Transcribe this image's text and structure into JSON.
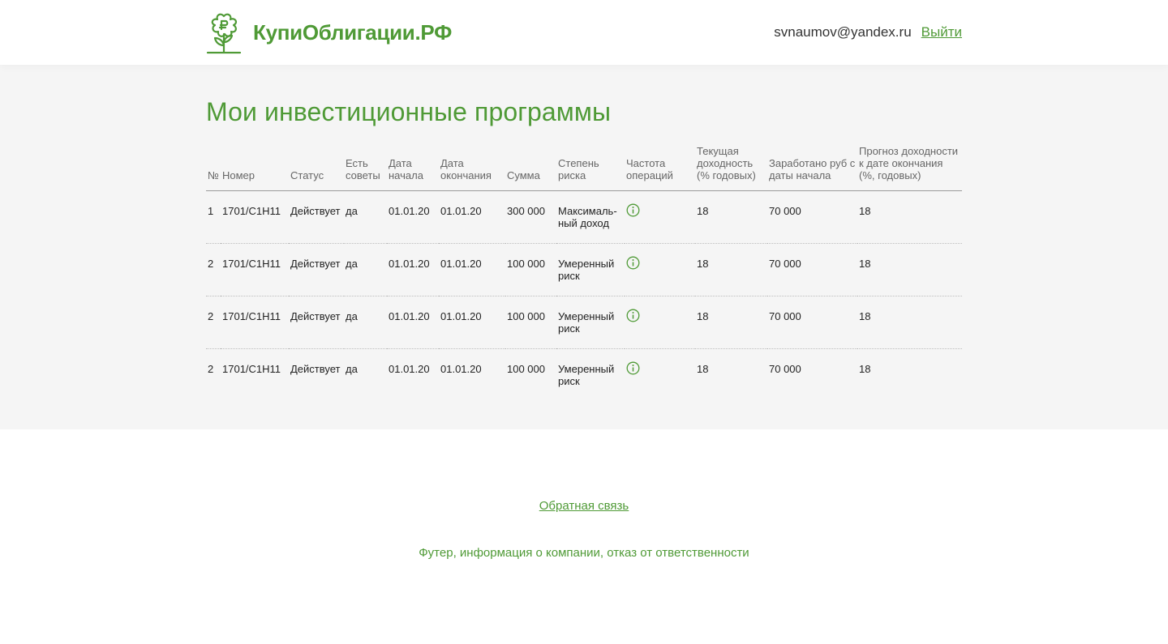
{
  "header": {
    "logo_text": "КупиОблигации.РФ",
    "logo_icon": "flower-ruble-icon",
    "user_email": "svnaumov@yandex.ru",
    "logout_label": "Выйти"
  },
  "main": {
    "title": "Мои инвестиционные программы",
    "columns": {
      "num": "№",
      "number": "Номер",
      "status": "Статус",
      "advice": "Есть советы",
      "start": "Дата начала",
      "end": "Дата окончания",
      "sum": "Сумма",
      "risk": "Степень риска",
      "freq": "Частота операций",
      "yield": "Текущая доходность (% годовых)",
      "earned": "Заработано руб с даты начала",
      "forecast": "Прогноз доходности к дате окончания (%, годовых)"
    },
    "rows": [
      {
        "num": "1",
        "number": "1701/C1H11",
        "status": "Действует",
        "advice": "да",
        "start": "01.01.20",
        "end": "01.01.20",
        "sum": "300 000",
        "risk": "Максималь-ный доход",
        "freq_icon": "info-icon",
        "yield": "18",
        "earned": "70 000",
        "forecast": "18"
      },
      {
        "num": "2",
        "number": "1701/C1H11",
        "status": "Действует",
        "advice": "да",
        "start": "01.01.20",
        "end": "01.01.20",
        "sum": "100 000",
        "risk": "Умеренный риск",
        "freq_icon": "info-icon",
        "yield": "18",
        "earned": "70 000",
        "forecast": "18"
      },
      {
        "num": "2",
        "number": "1701/C1H11",
        "status": "Действует",
        "advice": "да",
        "start": "01.01.20",
        "end": "01.01.20",
        "sum": "100 000",
        "risk": "Умеренный риск",
        "freq_icon": "info-icon",
        "yield": "18",
        "earned": "70 000",
        "forecast": "18"
      },
      {
        "num": "2",
        "number": "1701/C1H11",
        "status": "Действует",
        "advice": "да",
        "start": "01.01.20",
        "end": "01.01.20",
        "sum": "100 000",
        "risk": "Умеренный риск",
        "freq_icon": "info-icon",
        "yield": "18",
        "earned": "70 000",
        "forecast": "18"
      }
    ]
  },
  "footer": {
    "feedback_label": "Обратная связь",
    "info_text": "Футер, информация о компании, отказ от ответственности"
  },
  "colors": {
    "brand_green": "#4f9a36",
    "main_bg": "#f5f5f5"
  }
}
